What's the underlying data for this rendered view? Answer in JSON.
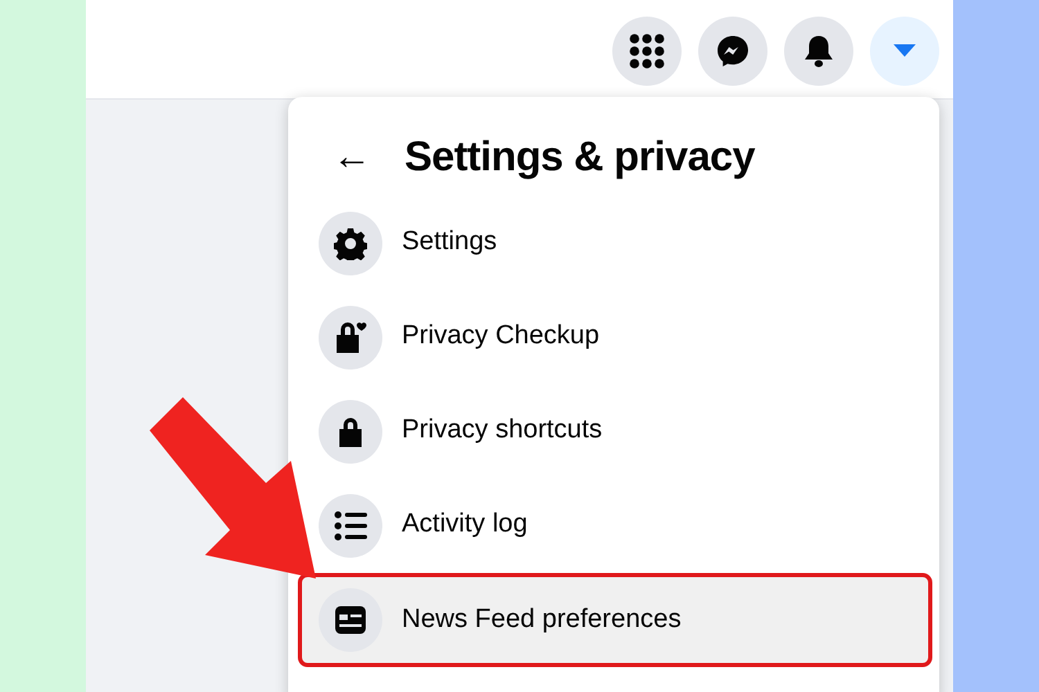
{
  "top_bar": {
    "buttons": [
      {
        "kind": "menu",
        "selected": false
      },
      {
        "kind": "messenger",
        "selected": false
      },
      {
        "kind": "notifications",
        "selected": false
      },
      {
        "kind": "account",
        "selected": true
      }
    ]
  },
  "menu": {
    "title": "Settings & privacy",
    "back_button": "←",
    "items": [
      {
        "kind": "settings",
        "label": "Settings",
        "selected": false
      },
      {
        "kind": "privacy_checkup",
        "label": "Privacy Checkup",
        "selected": false
      },
      {
        "kind": "privacy_shortcuts",
        "label": "Privacy shortcuts",
        "selected": false
      },
      {
        "kind": "activity_log",
        "label": "Activity log",
        "selected": false
      },
      {
        "kind": "news_feed",
        "label": "News Feed preferences",
        "selected": true
      }
    ]
  }
}
